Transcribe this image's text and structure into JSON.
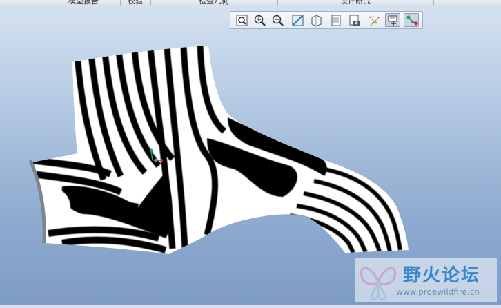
{
  "menu": {
    "tabs": [
      {
        "label": "模型报告"
      },
      {
        "label": "校验"
      },
      {
        "label": "检查几何"
      },
      {
        "label": "设计研究"
      }
    ]
  },
  "toolbar": {
    "buttons": [
      {
        "name": "refit-button",
        "icon": "refit-icon",
        "active": false
      },
      {
        "name": "zoom-in-button",
        "icon": "zoom-in-icon",
        "active": false
      },
      {
        "name": "zoom-out-button",
        "icon": "zoom-out-icon",
        "active": false
      },
      {
        "name": "repaint-button",
        "icon": "repaint-icon",
        "active": false
      },
      {
        "name": "display-style-button",
        "icon": "display-style-icon",
        "active": false
      },
      {
        "name": "saved-views-button",
        "icon": "saved-views-icon",
        "active": false
      },
      {
        "name": "view-manager-button",
        "icon": "view-manager-icon",
        "active": false
      },
      {
        "name": "datum-display-button",
        "icon": "datum-display-icon",
        "active": false
      },
      {
        "name": "annotation-display-button",
        "icon": "annotation-display-icon",
        "active": true
      },
      {
        "name": "csys-display-button",
        "icon": "csys-display-icon",
        "active": true
      }
    ]
  },
  "viewport": {
    "analysis": "reflection-stripes",
    "stripe_colors": [
      "#000000",
      "#ffffff"
    ],
    "background_top": "#d6e2f0",
    "background_bottom": "#7d9cc6"
  },
  "watermark": {
    "title": "野火论坛",
    "url": "www.proewildfire.cn"
  }
}
